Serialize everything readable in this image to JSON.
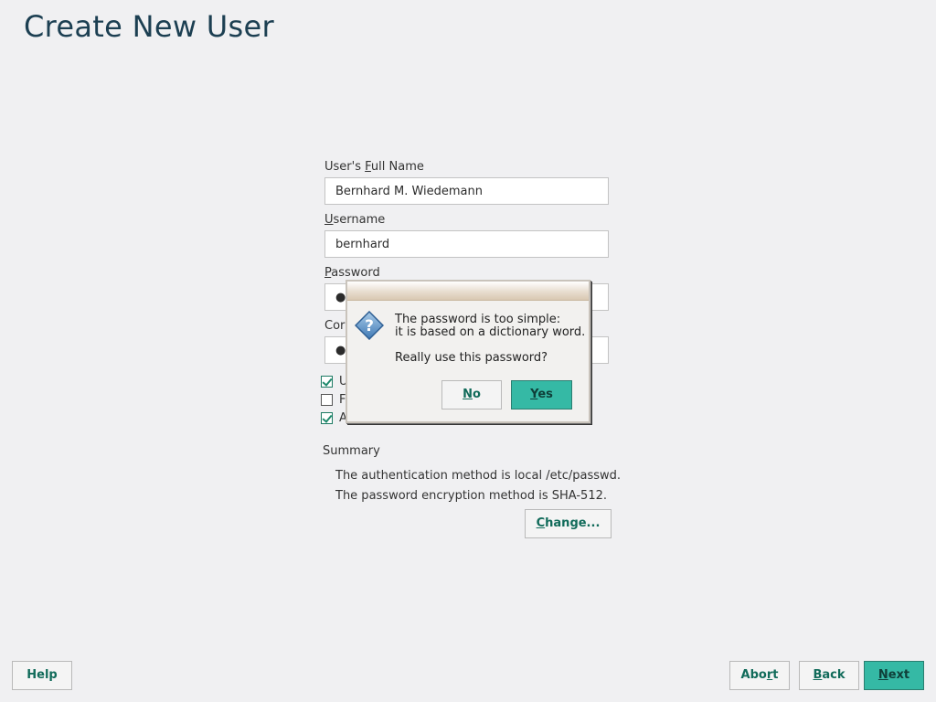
{
  "page": {
    "title": "Create New User"
  },
  "form": {
    "full_name_label_pre": "User's ",
    "full_name_label_u": "F",
    "full_name_label_post": "ull Name",
    "full_name_value": "Bernhard M. Wiedemann",
    "username_label_u": "U",
    "username_label_post": "sername",
    "username_value": "bernhard",
    "password_label_u": "P",
    "password_label_post": "assword",
    "password_value": "●",
    "confirm_label_visible": "Cor",
    "confirm_value": "●",
    "checkboxes": [
      {
        "label_visible": "U",
        "checked": true
      },
      {
        "label_visible": "F",
        "checked": false
      },
      {
        "label_visible": "A",
        "checked": true
      }
    ]
  },
  "summary": {
    "title": "Summary",
    "line1": "The authentication method is local /etc/passwd.",
    "line2": "The password encryption method is SHA-512.",
    "change_u": "C",
    "change_post": "hange..."
  },
  "dialog": {
    "icon": "question-icon",
    "message_line1": "The password is too simple:",
    "message_line2": "it is based on a dictionary word.",
    "question": "Really use this password?",
    "no_u": "N",
    "no_post": "o",
    "yes_u": "Y",
    "yes_post": "es"
  },
  "footer": {
    "help_label": "Help",
    "abort_pre": "Abo",
    "abort_u": "r",
    "abort_post": "t",
    "back_u": "B",
    "back_post": "ack",
    "next_u": "N",
    "next_post": "ext"
  },
  "colors": {
    "accent": "#35b9a5",
    "title": "#1c3f52",
    "link_text": "#116b5a"
  }
}
